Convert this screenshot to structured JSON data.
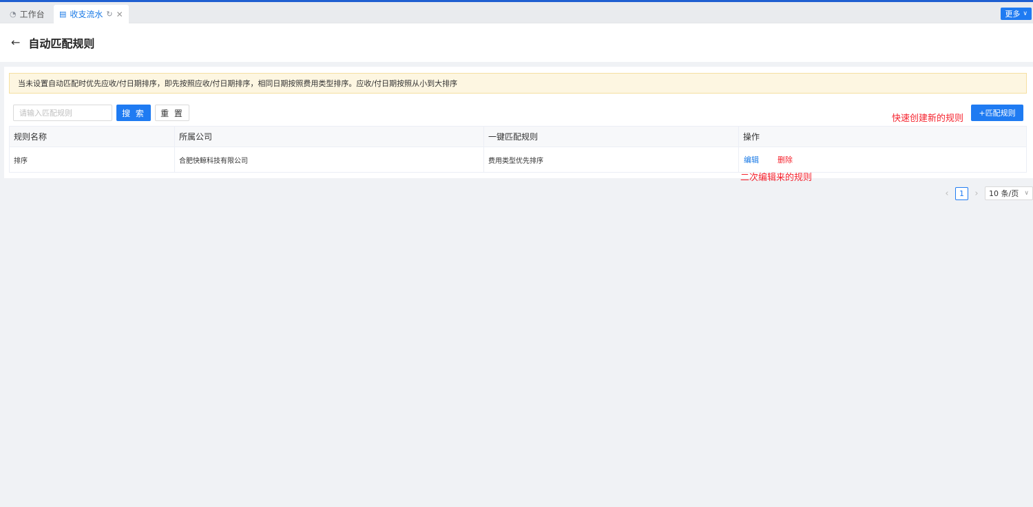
{
  "tabs": [
    {
      "label": "工作台",
      "icon": "dashboard-icon"
    },
    {
      "label": "收支流水",
      "icon": "document-icon",
      "active": true
    }
  ],
  "more_button": {
    "label": "更多"
  },
  "page": {
    "title": "自动匹配规则"
  },
  "notice": "当未设置自动匹配时优先应收/付日期排序，即先按照应收/付日期排序，相同日期按照费用类型排序。应收/付日期按照从小到大排序",
  "toolbar": {
    "search_placeholder": "请输入匹配规则",
    "search_label": "搜 索",
    "reset_label": "重 置",
    "add_label": "+匹配规则"
  },
  "annotations": {
    "create_note": "快速创建新的规则",
    "edit_note": "二次编辑来的规则"
  },
  "table": {
    "columns": [
      "规则名称",
      "所属公司",
      "一键匹配规则",
      "操作"
    ],
    "rows": [
      {
        "name": "排序",
        "company": "合肥快鲸科技有限公司",
        "rule": "费用类型优先排序",
        "edit": "编辑",
        "delete": "删除"
      }
    ]
  },
  "pagination": {
    "current": "1",
    "page_size": "10 条/页"
  },
  "colors": {
    "primary": "#1f7bf2",
    "danger": "#f5222d",
    "notice_bg": "#fdf6e1"
  }
}
